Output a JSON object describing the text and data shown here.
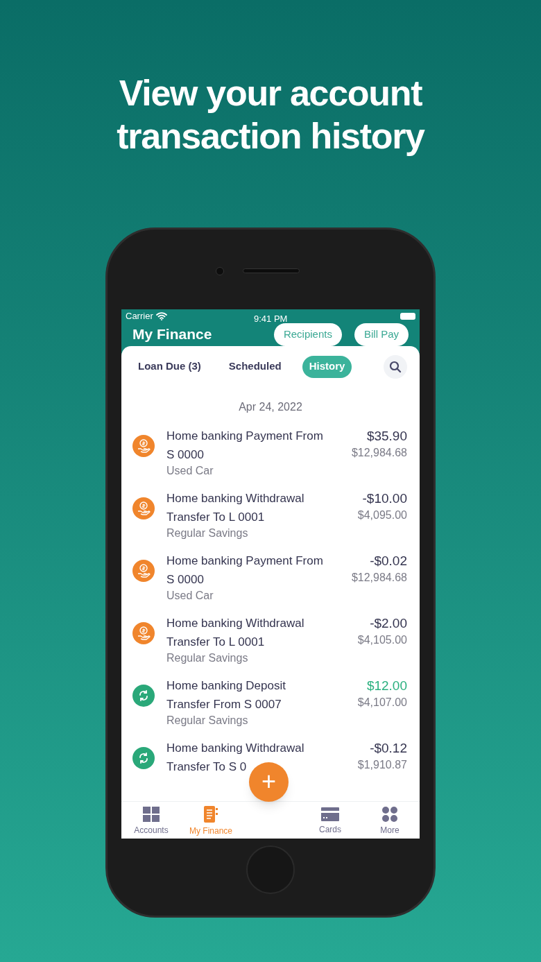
{
  "headline": [
    "View your account",
    "transaction history"
  ],
  "status_bar": {
    "carrier": "Carrier",
    "time": "9:41 PM"
  },
  "header": {
    "title": "My Finance",
    "buttons": [
      "Recipients",
      "Bill Pay"
    ]
  },
  "tabs": [
    {
      "label": "Loan Due (3)",
      "selected": false
    },
    {
      "label": "Scheduled",
      "selected": false
    },
    {
      "label": "History",
      "selected": true
    }
  ],
  "date": "Apr 24, 2022",
  "transactions": [
    {
      "kind": "payment",
      "title": "Home banking Payment From",
      "detail": "S 0000",
      "account": "Used Car",
      "amount": "$35.90",
      "balance": "$12,984.68",
      "credit": false
    },
    {
      "kind": "payment",
      "title": "Home banking Withdrawal",
      "detail": "Transfer To L 0001",
      "account": "Regular Savings",
      "amount": "-$10.00",
      "balance": "$4,095.00",
      "credit": false
    },
    {
      "kind": "payment",
      "title": "Home banking Payment From",
      "detail": "S 0000",
      "account": "Used Car",
      "amount": "-$0.02",
      "balance": "$12,984.68",
      "credit": false
    },
    {
      "kind": "payment",
      "title": "Home banking Withdrawal",
      "detail": "Transfer To L 0001",
      "account": "Regular Savings",
      "amount": "-$2.00",
      "balance": "$4,105.00",
      "credit": false
    },
    {
      "kind": "transfer",
      "title": "Home banking Deposit",
      "detail": "Transfer From S 0007",
      "account": "Regular Savings",
      "amount": "$12.00",
      "balance": "$4,107.00",
      "credit": true
    },
    {
      "kind": "transfer",
      "title": "Home banking Withdrawal",
      "detail": "Transfer To S 0",
      "amount": "-$0.12",
      "balance": "$1,910.87",
      "credit": false
    }
  ],
  "fab": "+",
  "nav": [
    {
      "kind": "accounts",
      "label": "Accounts",
      "selected": false
    },
    {
      "kind": "finance",
      "label": "My Finance",
      "selected": true
    },
    {
      "kind": "gap"
    },
    {
      "kind": "cards",
      "label": "Cards",
      "selected": false
    },
    {
      "kind": "more",
      "label": "More",
      "selected": false
    }
  ]
}
